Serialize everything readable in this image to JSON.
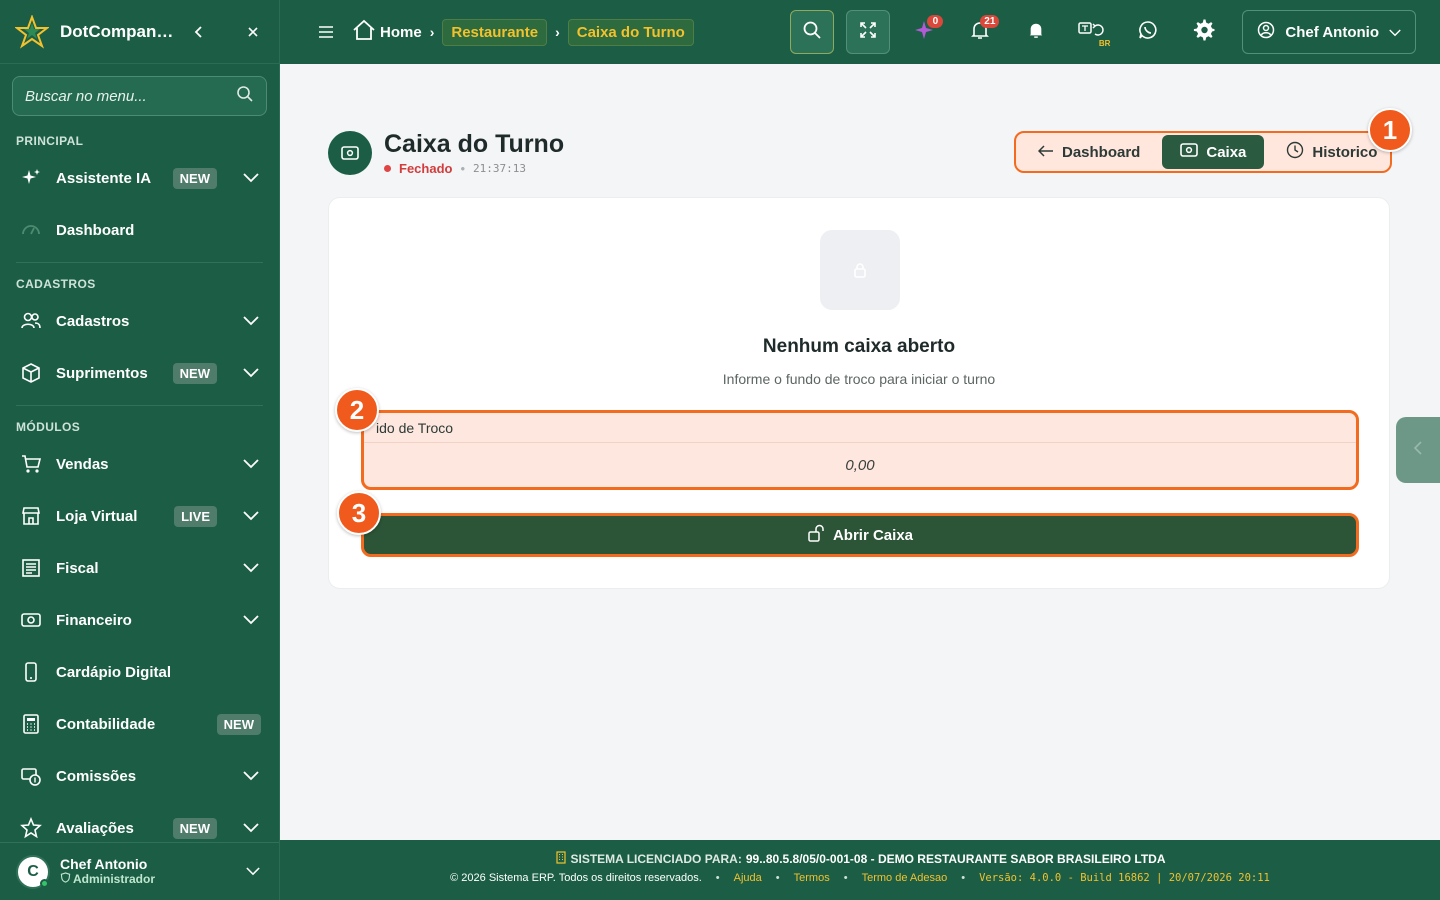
{
  "brand": {
    "name": "DotCompan…"
  },
  "sidebar": {
    "search_placeholder": "Buscar no menu...",
    "sections": {
      "principal": "PRINCIPAL",
      "cadastros": "CADASTROS",
      "modulos": "MÓDULOS"
    },
    "items": [
      {
        "label": "Assistente IA",
        "badge": "NEW",
        "icon": "sparkles-icon",
        "expandable": true
      },
      {
        "label": "Dashboard",
        "icon": "gauge-icon",
        "expandable": false
      },
      {
        "label": "Cadastros",
        "icon": "users-icon",
        "expandable": true
      },
      {
        "label": "Suprimentos",
        "badge": "NEW",
        "icon": "box-icon",
        "expandable": true
      },
      {
        "label": "Vendas",
        "icon": "cart-icon",
        "expandable": true
      },
      {
        "label": "Loja Virtual",
        "badge": "LIVE",
        "icon": "store-icon",
        "expandable": true
      },
      {
        "label": "Fiscal",
        "icon": "document-icon",
        "expandable": true
      },
      {
        "label": "Financeiro",
        "icon": "money-icon",
        "expandable": true
      },
      {
        "label": "Cardápio Digital",
        "icon": "phone-icon",
        "expandable": false
      },
      {
        "label": "Contabilidade",
        "badge": "NEW",
        "icon": "calculator-icon",
        "expandable": false
      },
      {
        "label": "Comissões",
        "icon": "commission-icon",
        "expandable": true
      },
      {
        "label": "Avaliações",
        "badge": "NEW",
        "icon": "star-icon",
        "expandable": true
      }
    ],
    "user": {
      "initial": "C",
      "name": "Chef Antonio",
      "role": "Administrador"
    }
  },
  "topbar": {
    "breadcrumb": {
      "home": "Home",
      "level1": "Restaurante",
      "level2": "Caixa do Turno"
    },
    "ai_count": "0",
    "notif_count": "21",
    "lang": "BR",
    "user": "Chef Antonio"
  },
  "page": {
    "title": "Caixa do Turno",
    "status": "Fechado",
    "time": "21:37:13",
    "tabs": {
      "dashboard": "Dashboard",
      "caixa": "Caixa",
      "historico": "Historico"
    },
    "markers": [
      "1",
      "2",
      "3"
    ],
    "empty_title": "Nenhum caixa aberto",
    "empty_sub": "Informe o fundo de troco para iniciar o turno",
    "field_label": "ido de Troco",
    "field_placeholder": "0,00",
    "open_button": "Abrir Caixa"
  },
  "footer": {
    "license_label": "SISTEMA LICENCIADO PARA:",
    "license_value": "99..80.5.8/05/0-001-08 - DEMO RESTAURANTE SABOR BRASILEIRO LTDA",
    "copyright": "© 2026 Sistema ERP. Todos os direitos reservados.",
    "links": [
      "Ajuda",
      "Termos",
      "Termo de Adesao"
    ],
    "version": "Versão: 4.0.0 - Build 16862 | 20/07/2026 20:11"
  },
  "colors": {
    "primary": "#1b5e45",
    "accent": "#f2c12e",
    "highlight": "#f26b1e",
    "danger": "#e04545"
  }
}
